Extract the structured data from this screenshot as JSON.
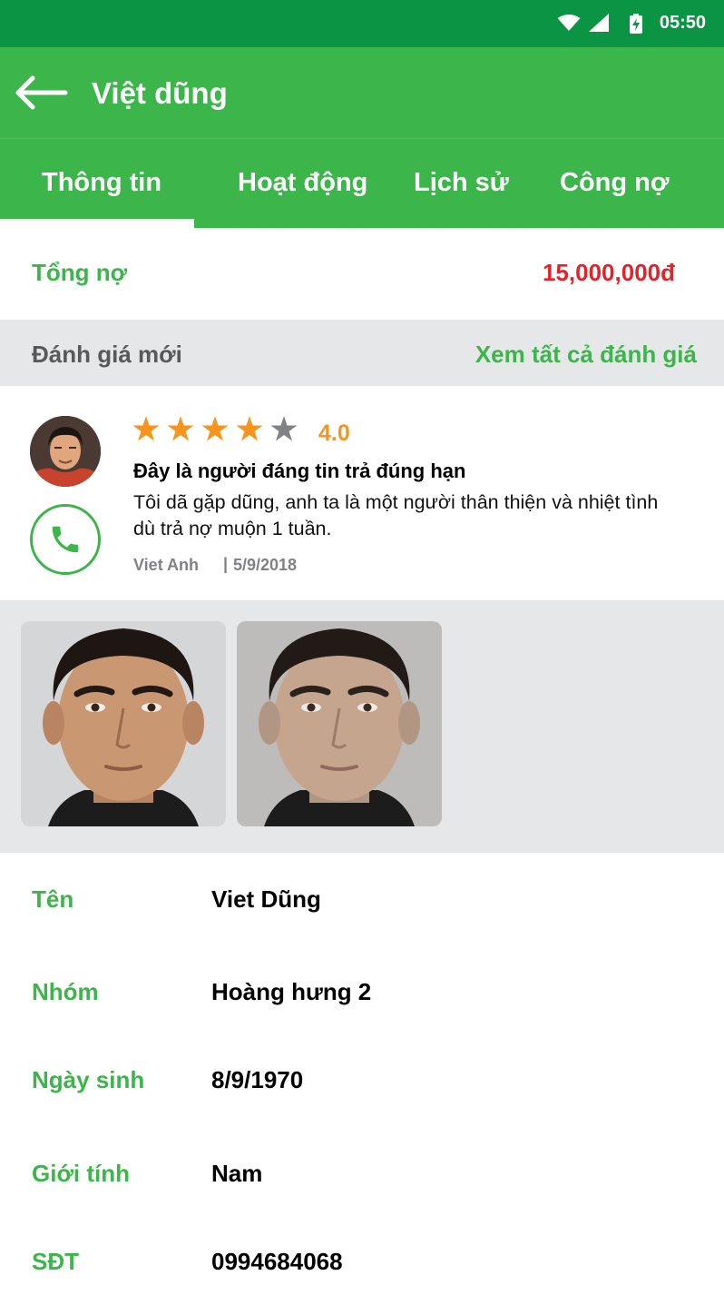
{
  "status_bar": {
    "time": "05:50",
    "icons": [
      "wifi-icon",
      "signal-icon",
      "battery-charging-icon"
    ]
  },
  "header": {
    "title": "Việt dũng",
    "back_icon": "arrow-left-icon"
  },
  "tabs": [
    {
      "label": "Thông tin",
      "active": true
    },
    {
      "label": "Hoạt động",
      "active": false
    },
    {
      "label": "Lịch sử",
      "active": false
    },
    {
      "label": "Công nợ",
      "active": false
    }
  ],
  "total_debt": {
    "label": "Tổng nợ",
    "value": "15,000,000đ"
  },
  "reviews_header": {
    "title": "Đánh giá mới",
    "see_all": "Xem tất cả đánh giá"
  },
  "review": {
    "stars_filled": 4,
    "stars_total": 5,
    "rating": "4.0",
    "title": "Đây là người đáng tin trả đúng hạn",
    "body": "Tôi dã gặp dũng, anh ta là một người thân thiện và nhiệt tình dù trả nợ muộn 1 tuần.",
    "author": "Viet Anh",
    "separator": "|",
    "date": "5/9/2018"
  },
  "photos_count": 2,
  "info": {
    "name_label": "Tên",
    "name_value": "Viet Dũng",
    "group_label": "Nhóm",
    "group_value": "Hoàng hưng 2",
    "dob_label": "Ngày sinh",
    "dob_value": "8/9/1970",
    "gender_label": "Giới tính",
    "gender_value": "Nam",
    "phone_label": "SĐT",
    "phone_value": "0994684068"
  },
  "colors": {
    "status_bar": "#0b9444",
    "primary": "#3cb54a",
    "debt_red": "#e3222a",
    "rating_orange": "#f7941d",
    "section_gray": "#e6e7e9",
    "muted_text": "#808285"
  }
}
